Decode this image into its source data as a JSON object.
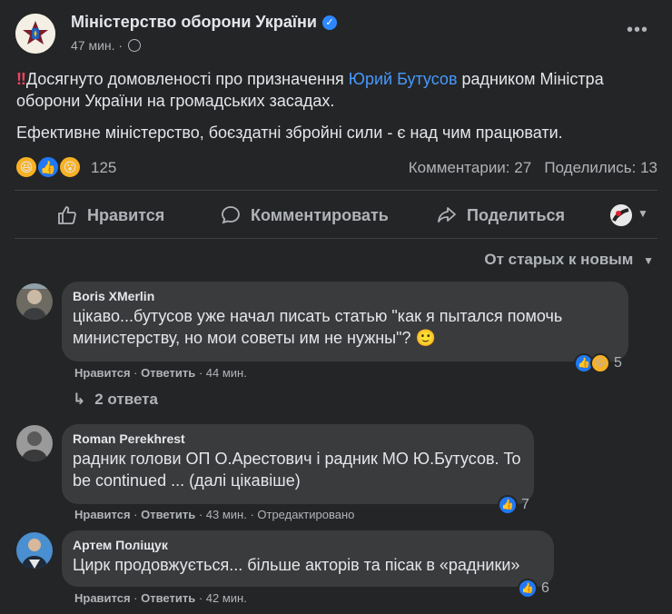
{
  "post": {
    "page_name": "Міністерство оборони України",
    "time": "47 мин.",
    "text_prefix": "Досягнуто домовленості про призначення ",
    "mention": "Юрий Бутусов",
    "text_suffix": " радником Міністра оборони України на громадських засадах.",
    "text2": "Ефективне міністерство, боєздатні збройні сили - є над чим працювати.",
    "reaction_count": "125",
    "comments_count": "Комментарии: 27",
    "shares_count": "Поделились: 13",
    "icons": [
      "verified-icon",
      "globe-icon",
      "more-icon",
      "haha-icon",
      "like-icon",
      "wow-icon"
    ]
  },
  "actions": {
    "like": "Нравится",
    "comment": "Комментировать",
    "share": "Поделиться"
  },
  "sort_label": "От старых к новым",
  "comments": [
    {
      "author": "Boris XMerlin",
      "text": "цікаво...бутусов уже начал писать статью \"как я пытался помочь министерству, но мои советы им не нужны\"? 🙂",
      "like": "Нравится",
      "reply": "Ответить",
      "time": "44 мин.",
      "reactions": "5",
      "replies": "2 ответа"
    },
    {
      "author": "Roman Perekhrest",
      "text": "радник голови ОП О.Арестович і радник МО Ю.Бутусов. To be continued ... (далі цікавіше)",
      "like": "Нравится",
      "reply": "Ответить",
      "time": "43 мин.",
      "edited": "Отредактировано",
      "reactions": "7"
    },
    {
      "author": "Артем Поліщук",
      "text": "Цирк продовжується... більше акторів та пісак в «радники»",
      "like": "Нравится",
      "reply": "Ответить",
      "time": "42 мин.",
      "reactions": "6"
    }
  ],
  "colors": {
    "background": "#242526",
    "bubble": "#3a3b3c",
    "link": "#4599ff",
    "like_blue": "#2078f4",
    "emoji_yellow": "#f7b125"
  }
}
